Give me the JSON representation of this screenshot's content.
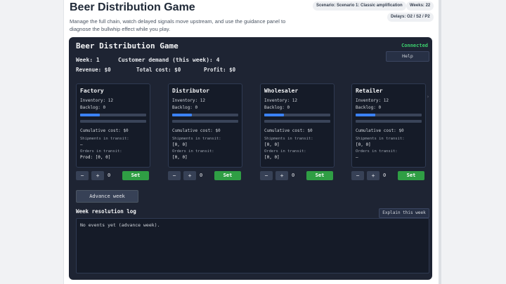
{
  "header": {
    "title": "Beer Distribution Game",
    "description": "Manage the full chain, watch delayed signals move upstream, and use the guidance panel to diagnose the bullwhip effect while you play.",
    "scenario": "Scenario: Scenario 1: Classic amplification",
    "weeks": "Weeks: 22",
    "delays": "Delays: O2 / S2 / P2"
  },
  "panel": {
    "title": "Beer Distribution Game",
    "status": "Connected",
    "help_label": "Help",
    "week": "Week: 1",
    "customer_demand": "Customer demand (this week): 4",
    "revenue": "Revenue: $0",
    "total_cost": "Total cost: $0",
    "profit": "Profit: $0"
  },
  "stages": [
    {
      "name": "Factory",
      "inventory": "Inventory: 12",
      "backlog": "Backlog: 0",
      "inventory_fill": 0.3,
      "backlog_fill": 0,
      "cumulative": "Cumulative cost: $0",
      "shipments_label": "Shipments in transit:",
      "shipments": "—",
      "orders_label": "Orders in transit:",
      "orders": "Prod: [0, 0]",
      "qty": "0"
    },
    {
      "name": "Distributor",
      "inventory": "Inventory: 12",
      "backlog": "Backlog: 0",
      "inventory_fill": 0.3,
      "backlog_fill": 0,
      "cumulative": "Cumulative cost: $0",
      "shipments_label": "Shipments in transit:",
      "shipments": "[0, 0]",
      "orders_label": "Orders in transit:",
      "orders": "[0, 0]",
      "qty": "0"
    },
    {
      "name": "Wholesaler",
      "inventory": "Inventory: 12",
      "backlog": "Backlog: 0",
      "inventory_fill": 0.3,
      "backlog_fill": 0,
      "cumulative": "Cumulative cost: $0",
      "shipments_label": "Shipments in transit:",
      "shipments": "[0, 0]",
      "orders_label": "Orders in transit:",
      "orders": "[0, 0]",
      "qty": "0"
    },
    {
      "name": "Retailer",
      "inventory": "Inventory: 12",
      "backlog": "Backlog: 0",
      "inventory_fill": 0.3,
      "backlog_fill": 0,
      "cumulative": "Cumulative cost: $0",
      "shipments_label": "Shipments in transit:",
      "shipments": "[0, 0]",
      "orders_label": "Orders in transit:",
      "orders": "—",
      "qty": "0"
    }
  ],
  "controls": {
    "minus": "−",
    "plus": "+",
    "set_label": "Set",
    "advance_label": "Advance week"
  },
  "log": {
    "title": "Week resolution log",
    "explain_label": "Explain this week",
    "text": "No events yet (advance week)."
  }
}
